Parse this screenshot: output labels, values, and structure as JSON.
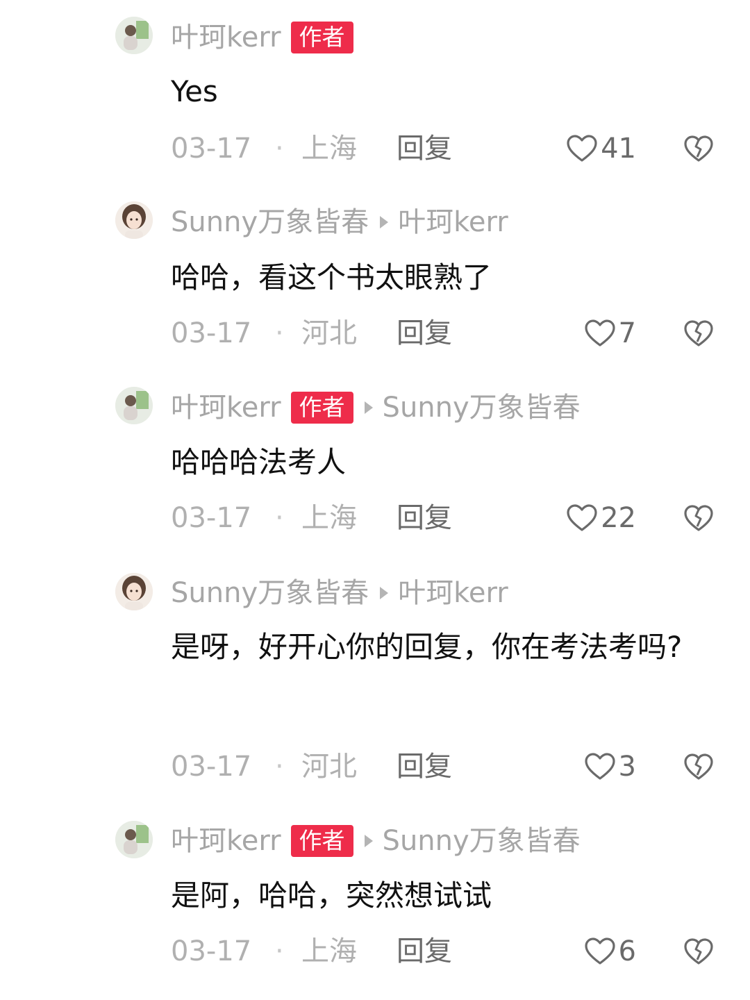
{
  "comments": [
    {
      "user": "叶珂kerr",
      "author_badge": "作者",
      "reply_to": "",
      "text": "Yes",
      "date": "03-17",
      "separator": "·",
      "location": "上海",
      "reply_label": "回复",
      "likes": "41"
    },
    {
      "user": "Sunny万象皆春",
      "author_badge": "",
      "reply_to": "叶珂kerr",
      "text": "哈哈，看这个书太眼熟了",
      "date": "03-17",
      "separator": "·",
      "location": "河北",
      "reply_label": "回复",
      "likes": "7"
    },
    {
      "user": "叶珂kerr",
      "author_badge": "作者",
      "reply_to": "Sunny万象皆春",
      "text": "哈哈哈法考人",
      "date": "03-17",
      "separator": "·",
      "location": "上海",
      "reply_label": "回复",
      "likes": "22"
    },
    {
      "user": "Sunny万象皆春",
      "author_badge": "",
      "reply_to": "叶珂kerr",
      "text": "是呀，好开心你的回复，你在考法考吗?",
      "date": "03-17",
      "separator": "·",
      "location": "河北",
      "reply_label": "回复",
      "likes": "3"
    },
    {
      "user": "叶珂kerr",
      "author_badge": "作者",
      "reply_to": "Sunny万象皆春",
      "text": "是阿，哈哈，突然想试试",
      "date": "03-17",
      "separator": "·",
      "location": "上海",
      "reply_label": "回复",
      "likes": "6"
    }
  ],
  "icons": {
    "like": "heart-outline-icon",
    "dislike": "broken-heart-icon",
    "reply_arrow": "triangle-right-icon"
  },
  "colors": {
    "author_badge": "#ee2c4a",
    "username": "#a6a6a6",
    "meta": "#b0b0b0",
    "action": "#6a6a6a",
    "text": "#111111"
  }
}
